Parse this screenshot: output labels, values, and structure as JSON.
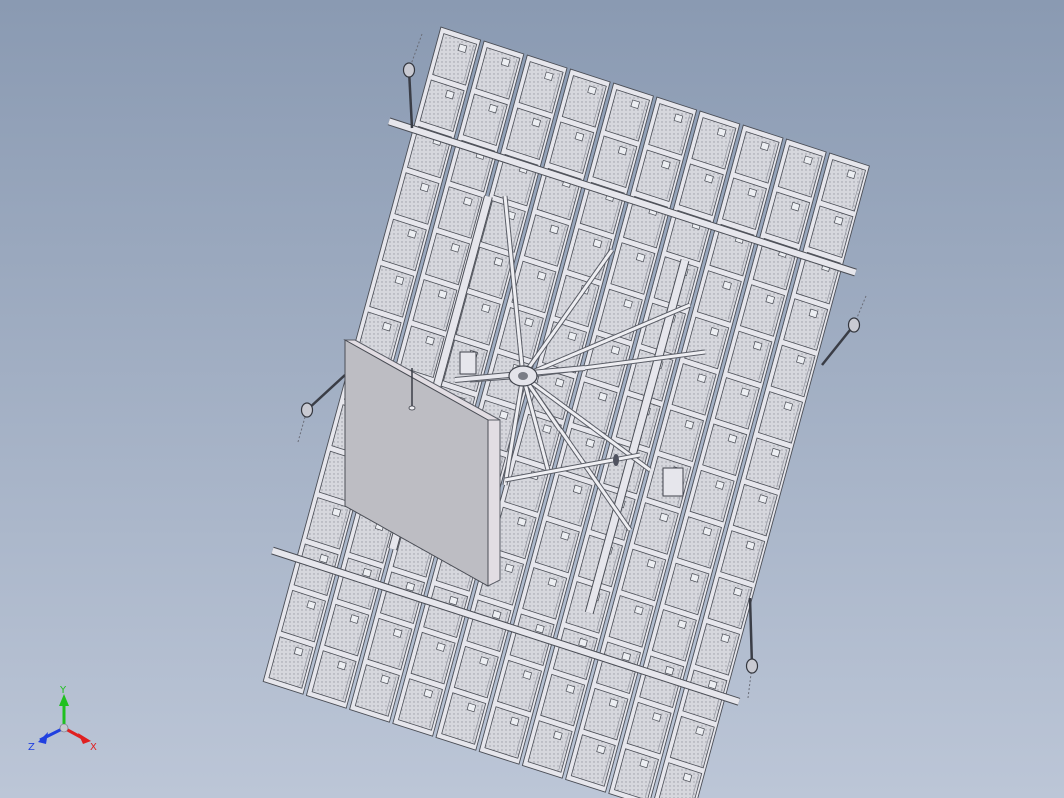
{
  "model_view": {
    "panel_columns": 10,
    "panels_per_column": 14,
    "colors": {
      "background_top": "#8a9ab2",
      "background_bottom": "#bcc6d7",
      "panel_fill": "#d4d5db",
      "panel_edge": "#4a4d55",
      "frame": "#e6e6ec",
      "box_front": "#bdbdc3",
      "box_side": "#e2dde3"
    }
  },
  "triad": {
    "x_label": "X",
    "y_label": "Y",
    "z_label": "Z",
    "x_color": "#e02020",
    "y_color": "#20c020",
    "z_color": "#2040e0"
  }
}
